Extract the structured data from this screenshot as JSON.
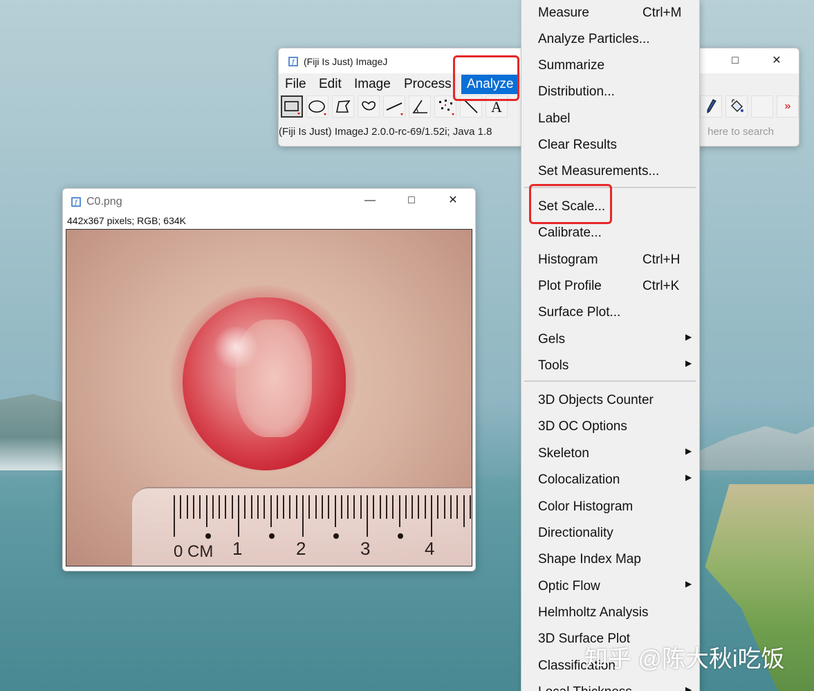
{
  "main_window": {
    "title": "(Fiji Is Just) ImageJ",
    "menus": [
      "File",
      "Edit",
      "Image",
      "Process",
      "Analyze"
    ],
    "active_menu": "Analyze",
    "status": "(Fiji Is Just) ImageJ 2.0.0-rc-69/1.52i; Java 1.8",
    "search_hint": "here to search",
    "maximize_glyph": "□",
    "close_glyph": "✕",
    "more_tools": "»"
  },
  "image_window": {
    "title": "C0.png",
    "info": "442x367 pixels; RGB; 634K",
    "minimize_glyph": "—",
    "maximize_glyph": "□",
    "close_glyph": "✕",
    "ruler_labels": [
      "0 CM",
      "1",
      "2",
      "3",
      "4"
    ]
  },
  "analyze_menu": {
    "items": [
      {
        "label": "Measure",
        "shortcut": "Ctrl+M"
      },
      {
        "label": "Analyze Particles..."
      },
      {
        "label": "Summarize"
      },
      {
        "label": "Distribution..."
      },
      {
        "label": "Label"
      },
      {
        "label": "Clear Results"
      },
      {
        "label": "Set Measurements..."
      },
      {
        "label": "Set Scale..."
      },
      {
        "label": "Calibrate..."
      },
      {
        "label": "Histogram",
        "shortcut": "Ctrl+H"
      },
      {
        "label": "Plot Profile",
        "shortcut": "Ctrl+K"
      },
      {
        "label": "Surface Plot..."
      },
      {
        "label": "Gels",
        "submenu": true
      },
      {
        "label": "Tools",
        "submenu": true
      },
      {
        "label": "3D Objects Counter"
      },
      {
        "label": "3D OC Options"
      },
      {
        "label": "Skeleton",
        "submenu": true
      },
      {
        "label": "Colocalization",
        "submenu": true
      },
      {
        "label": "Color Histogram"
      },
      {
        "label": "Directionality"
      },
      {
        "label": "Shape Index Map"
      },
      {
        "label": "Optic Flow",
        "submenu": true
      },
      {
        "label": "Helmholtz Analysis"
      },
      {
        "label": "3D Surface Plot"
      },
      {
        "label": "Classification"
      },
      {
        "label": "Local Thickness",
        "submenu": true
      }
    ],
    "submenu_glyph": "▶"
  },
  "highlight_color": "#e62828",
  "watermark": "知乎 @陈大秋i吃饭"
}
